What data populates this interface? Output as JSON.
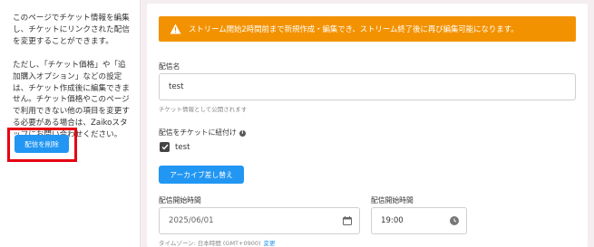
{
  "sidebar": {
    "paragraph1": "このページでチケット情報を編集し、チケットにリンクされた配信を変更することができます。",
    "paragraph2": "ただし、「チケット価格」や「追加購入オプション」などの設定は、チケット作成後に編集できません。チケット価格やこのページで利用できない他の項目を変更する必要がある場合は、Zaikoスタッフにお問い合わせください。",
    "delete_button": "配信を削除"
  },
  "warning": {
    "text": "ストリーム開始2時間前まで新規作成・編集でき、ストリーム終了後に再び編集可能になります。",
    "icon": "warning-icon"
  },
  "form": {
    "stream_name_label": "配信名",
    "stream_name_value": "test",
    "stream_name_helper": "チケット情報として公開されます",
    "link_label": "配信をチケットに紐付け",
    "link_checkbox_label": "test",
    "link_checked": true,
    "archive_button": "アーカイブ差し替え",
    "start_date_label": "配信開始時間",
    "start_date_value": "2025/06/01",
    "start_time_label": "配信開始時間",
    "start_time_value": "19:00",
    "timezone_text": "タイムゾーン: 日本時間 (GMT+0900)",
    "timezone_change": "変更"
  },
  "colors": {
    "accent": "#2196f3",
    "warning": "#f39200",
    "highlight": "#e60012"
  }
}
